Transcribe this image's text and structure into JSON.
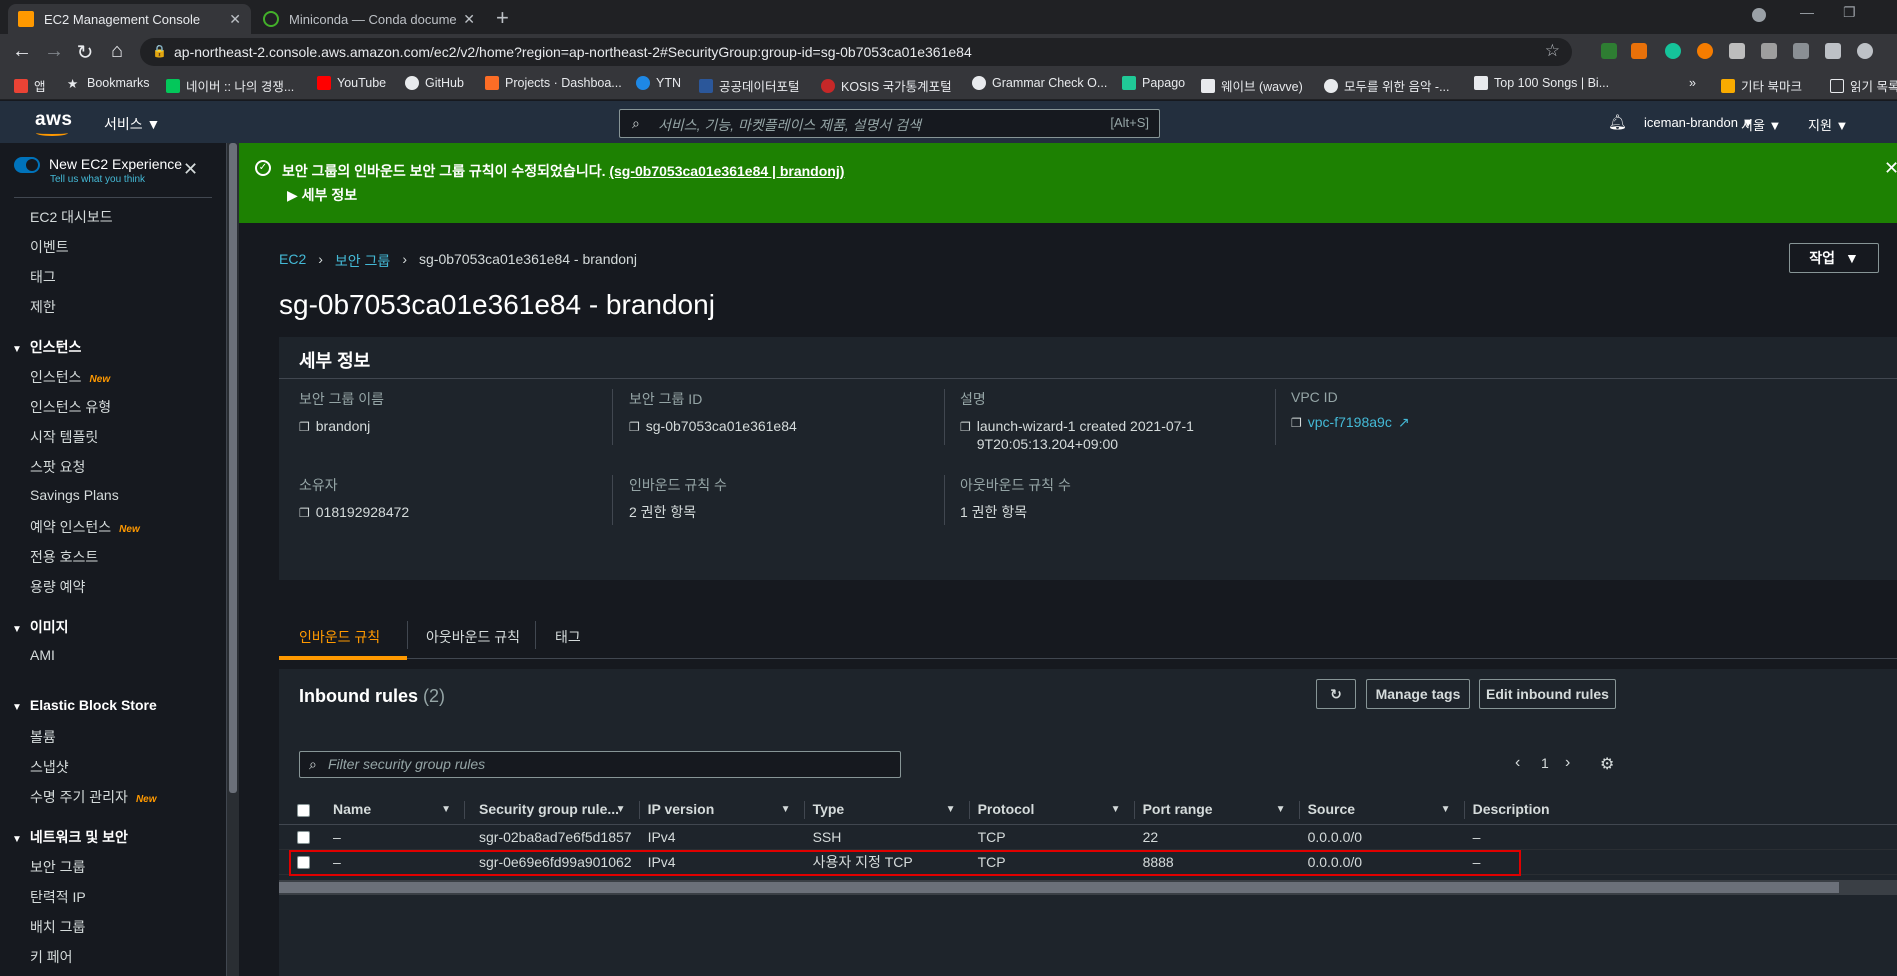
{
  "browser": {
    "tabs": [
      {
        "title": "EC2 Management Console",
        "active": true
      },
      {
        "title": "Miniconda — Conda documentati...",
        "active": false
      }
    ],
    "url": "ap-northeast-2.console.aws.amazon.com/ec2/v2/home?region=ap-northeast-2#SecurityGroup:group-id=sg-0b7053ca01e361e84",
    "bookmarks": [
      "앱",
      "Bookmarks",
      "네이버 :: 나의 경쟁...",
      "YouTube",
      "GitHub",
      "Projects · Dashboa...",
      "YTN",
      "공공데이터포털",
      "KOSIS 국가통계포털",
      "Grammar Check O...",
      "Papago",
      "웨이브 (wavve)",
      "모두를 위한 음악 -...",
      "Top 100 Songs | Bi...",
      "기타 북마크",
      "읽기 목록"
    ]
  },
  "aws_header": {
    "logo": "aws",
    "services": "서비스",
    "search_placeholder": "서비스, 기능, 마켓플레이스 제품, 설명서 검색",
    "search_shortcut": "[Alt+S]",
    "user": "iceman-brandon",
    "region": "서울",
    "support": "지원"
  },
  "sidebar": {
    "new_experience": "New EC2 Experience",
    "new_experience_link": "Tell us what you think",
    "items_top": [
      "EC2 대시보드",
      "이벤트",
      "태그",
      "제한"
    ],
    "sections": [
      {
        "title": "인스턴스",
        "items": [
          {
            "label": "인스턴스",
            "new": "New"
          },
          {
            "label": "인스턴스 유형"
          },
          {
            "label": "시작 템플릿"
          },
          {
            "label": "스팟 요청"
          },
          {
            "label": "Savings Plans"
          },
          {
            "label": "예약 인스턴스",
            "new": "New"
          },
          {
            "label": "전용 호스트"
          },
          {
            "label": "용량 예약"
          }
        ]
      },
      {
        "title": "이미지",
        "items": [
          {
            "label": "AMI"
          }
        ]
      },
      {
        "title": "Elastic Block Store",
        "items": [
          {
            "label": "볼륨"
          },
          {
            "label": "스냅샷"
          },
          {
            "label": "수명 주기 관리자",
            "new": "New"
          }
        ]
      },
      {
        "title": "네트워크 및 보안",
        "items": [
          {
            "label": "보안 그룹"
          },
          {
            "label": "탄력적 IP"
          },
          {
            "label": "배치 그룹"
          },
          {
            "label": "키 페어"
          }
        ]
      }
    ]
  },
  "flash": {
    "message": "보안 그룹의 인바운드 보안 그룹 규칙이 수정되었습니다.",
    "link": "(sg-0b7053ca01e361e84 | brandonj)",
    "details": "세부 정보"
  },
  "breadcrumb": [
    "EC2",
    "보안 그룹",
    "sg-0b7053ca01e361e84 - brandonj"
  ],
  "page_title": "sg-0b7053ca01e361e84 - brandonj",
  "action_button": "작업",
  "details": {
    "header": "세부 정보",
    "fields": [
      {
        "label": "보안 그룹 이름",
        "value": "brandonj"
      },
      {
        "label": "보안 그룹 ID",
        "value": "sg-0b7053ca01e361e84"
      },
      {
        "label": "설명",
        "value": "launch-wizard-1 created 2021-07-19T20:05:13.204+09:00"
      },
      {
        "label": "VPC ID",
        "value": "vpc-f7198a9c"
      },
      {
        "label": "소유자",
        "value": "018192928472"
      },
      {
        "label": "인바운드 규칙 수",
        "value": "2 권한 항목"
      },
      {
        "label": "아웃바운드 규칙 수",
        "value": "1 권한 항목"
      }
    ]
  },
  "tabs": [
    "인바운드 규칙",
    "아웃바운드 규칙",
    "태그"
  ],
  "inbound": {
    "title": "Inbound rules",
    "count": "(2)",
    "manage_tags": "Manage tags",
    "edit_rules": "Edit inbound rules",
    "filter_placeholder": "Filter security group rules",
    "page": "1",
    "columns": [
      "Name",
      "Security group rule...",
      "IP version",
      "Type",
      "Protocol",
      "Port range",
      "Source",
      "Description"
    ],
    "rows": [
      [
        "–",
        "sgr-02ba8ad7e6f5d1857",
        "IPv4",
        "SSH",
        "TCP",
        "22",
        "0.0.0.0/0",
        "–"
      ],
      [
        "–",
        "sgr-0e69e6fd99a901062",
        "IPv4",
        "사용자 지정 TCP",
        "TCP",
        "8888",
        "0.0.0.0/0",
        "–"
      ]
    ]
  },
  "colors": {
    "accent": "#ff9900",
    "link": "#44b9d6",
    "success": "#1d8102",
    "highlight": "#e00000"
  }
}
